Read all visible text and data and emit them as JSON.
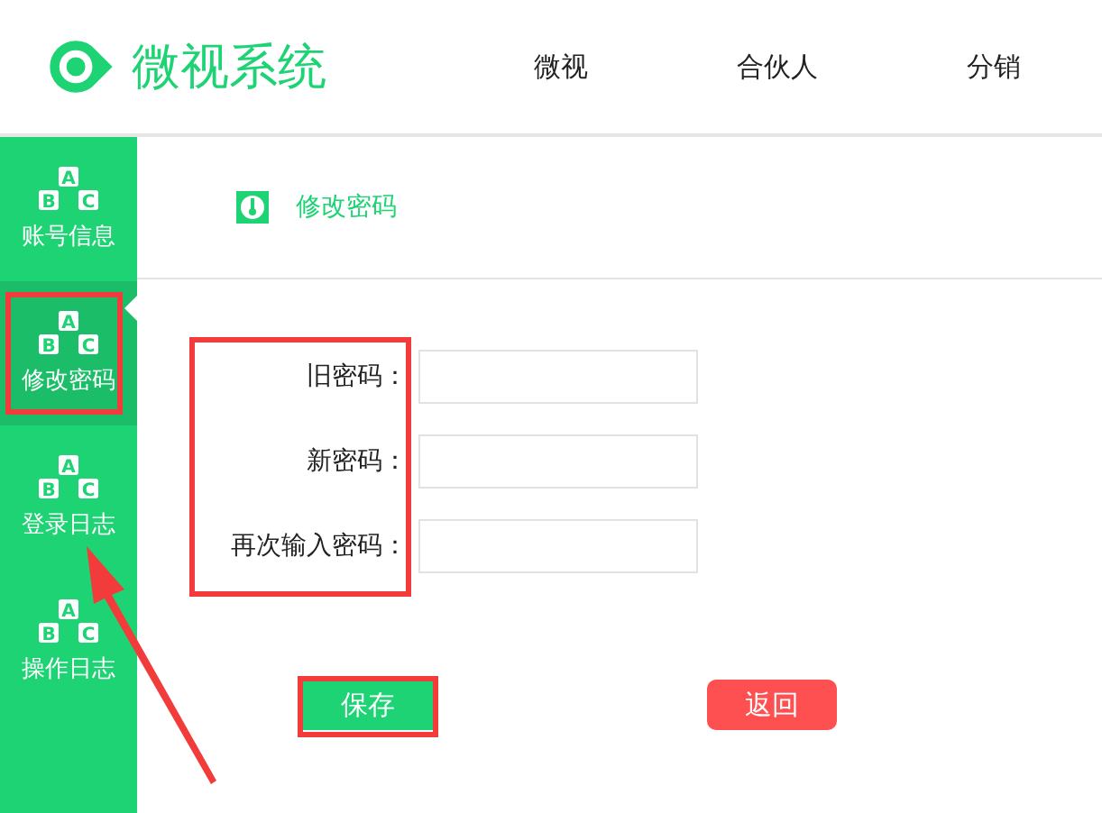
{
  "header": {
    "title": "微视系统",
    "nav": [
      {
        "label": "微视"
      },
      {
        "label": "合伙人"
      },
      {
        "label": "分销"
      }
    ]
  },
  "sidebar": {
    "items": [
      {
        "label": "账号信息",
        "selected": false,
        "icon_letters": [
          "A",
          "B",
          "C"
        ]
      },
      {
        "label": "修改密码",
        "selected": true,
        "icon_letters": [
          "A",
          "B",
          "C"
        ]
      },
      {
        "label": "登录日志",
        "selected": false,
        "icon_letters": [
          "A",
          "B",
          "C"
        ]
      },
      {
        "label": "操作日志",
        "selected": false,
        "icon_letters": [
          "A",
          "B",
          "C"
        ]
      }
    ]
  },
  "breadcrumb": {
    "label": "修改密码"
  },
  "form": {
    "fields": [
      {
        "label": "旧密码："
      },
      {
        "label": "新密码："
      },
      {
        "label": "再次输入密码："
      }
    ]
  },
  "buttons": [
    {
      "label": "保存",
      "kind": "primary"
    },
    {
      "label": "返回",
      "kind": "danger"
    }
  ]
}
